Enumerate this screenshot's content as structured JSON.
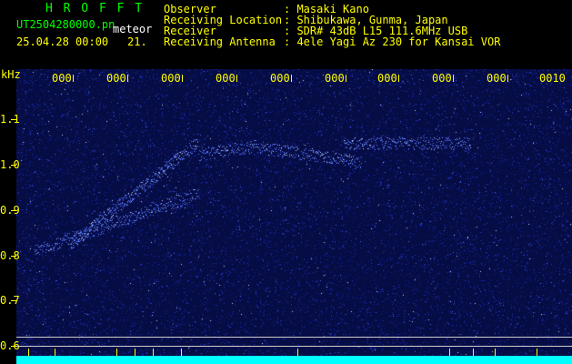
{
  "header": {
    "title": "H R O F F T",
    "filename": "UT2504280000.pn",
    "meteor_label": "meteor",
    "datetime": "25.04.28 00:00",
    "count": "21.",
    "fields": [
      {
        "label": "Observer",
        "value": ": Masaki Kano"
      },
      {
        "label": "Receiving Location",
        "value": ": Shibukawa, Gunma, Japan"
      },
      {
        "label": "Receiver",
        "value": ": SDR# 43dB L15 111.6MHz USB"
      },
      {
        "label": "Receiving Antenna",
        "value": ": 4ele Yagi Az 230 for Kansai VOR"
      }
    ]
  },
  "axis": {
    "y_unit": "kHz",
    "y_ticks": [
      "1.1",
      "1.0",
      "0.9",
      "0.8",
      "0.7",
      "0.6"
    ],
    "column_labels": [
      "000",
      "000",
      "000",
      "000",
      "000",
      "000",
      "000",
      "000",
      "000",
      "0010"
    ]
  },
  "colors": {
    "header_yellow": "#ffff00",
    "title_green": "#00ff00",
    "background_blue": "#060c44",
    "noise_blue": "#2a4cff",
    "bottom_bar": "#00ffff"
  }
}
